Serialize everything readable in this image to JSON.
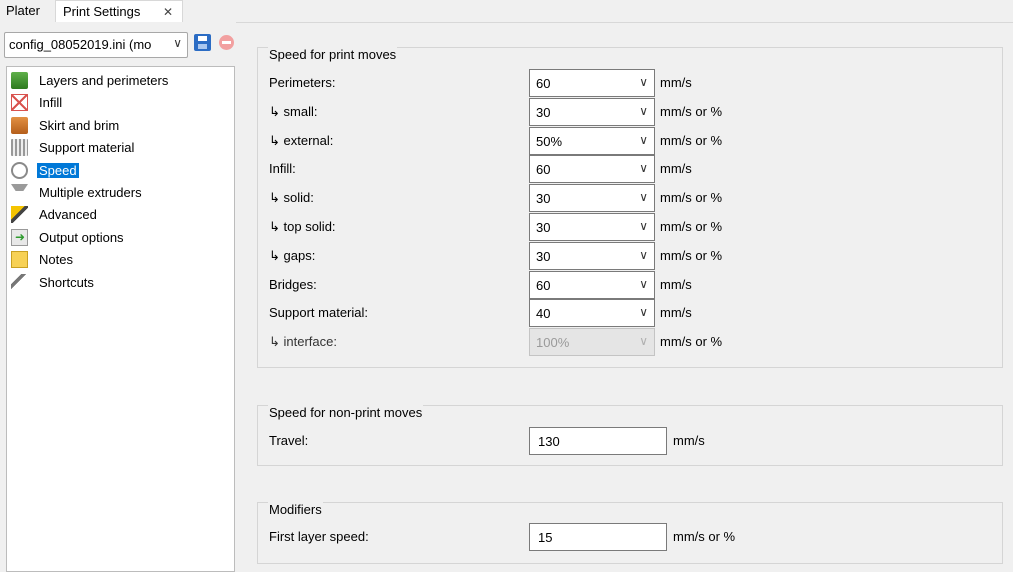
{
  "tabs": {
    "plater": "Plater",
    "print_settings": "Print Settings",
    "close_glyph": "✕"
  },
  "config": {
    "selected": "config_08052019.ini (mo",
    "chevron": "∨"
  },
  "tree": [
    {
      "label": "Layers and perimeters",
      "icon": "layers-icon",
      "selected": false
    },
    {
      "label": "Infill",
      "icon": "infill-icon",
      "selected": false
    },
    {
      "label": "Skirt and brim",
      "icon": "skirt-brim-icon",
      "selected": false
    },
    {
      "label": "Support material",
      "icon": "support-material-icon",
      "selected": false
    },
    {
      "label": "Speed",
      "icon": "speed-clock-icon",
      "selected": true
    },
    {
      "label": "Multiple extruders",
      "icon": "funnel-icon",
      "selected": false
    },
    {
      "label": "Advanced",
      "icon": "wand-icon",
      "selected": false
    },
    {
      "label": "Output options",
      "icon": "output-arrow-icon",
      "selected": false
    },
    {
      "label": "Notes",
      "icon": "notes-icon",
      "selected": false
    },
    {
      "label": "Shortcuts",
      "icon": "wrench-icon",
      "selected": false
    }
  ],
  "print_moves": {
    "title": "Speed for print moves",
    "rows": [
      {
        "label": "Perimeters:",
        "value": "60",
        "unit": "mm/s",
        "enabled": true
      },
      {
        "label": "↳ small:",
        "value": "30",
        "unit": "mm/s or %",
        "enabled": true
      },
      {
        "label": "↳ external:",
        "value": "50%",
        "unit": "mm/s or %",
        "enabled": true
      },
      {
        "label": "Infill:",
        "value": "60",
        "unit": "mm/s",
        "enabled": true
      },
      {
        "label": "↳ solid:",
        "value": "30",
        "unit": "mm/s or %",
        "enabled": true
      },
      {
        "label": "↳ top solid:",
        "value": "30",
        "unit": "mm/s or %",
        "enabled": true
      },
      {
        "label": "↳ gaps:",
        "value": "30",
        "unit": "mm/s or %",
        "enabled": true
      },
      {
        "label": "Bridges:",
        "value": "60",
        "unit": "mm/s",
        "enabled": true
      },
      {
        "label": "Support material:",
        "value": "40",
        "unit": "mm/s",
        "enabled": true
      },
      {
        "label": "↳ interface:",
        "value": "100%",
        "unit": "mm/s or %",
        "enabled": false
      }
    ]
  },
  "non_print_moves": {
    "title": "Speed for non-print moves",
    "travel_label": "Travel:",
    "travel_value": "130",
    "travel_unit": "mm/s"
  },
  "modifiers": {
    "title": "Modifiers",
    "first_layer_label": "First layer speed:",
    "first_layer_value": "15",
    "first_layer_unit": "mm/s or %"
  },
  "chevron_glyph": "∨"
}
